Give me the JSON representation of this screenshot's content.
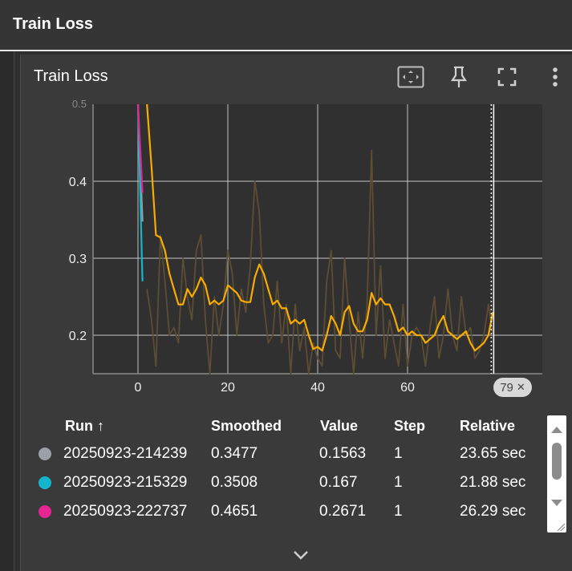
{
  "header": {
    "title": "Train Loss"
  },
  "card": {
    "title": "Train Loss",
    "tools": [
      {
        "name": "fit-domain-icon"
      },
      {
        "name": "pin-icon"
      },
      {
        "name": "fullscreen-icon"
      },
      {
        "name": "more-vert-icon"
      }
    ]
  },
  "colors": {
    "run1": "#9aa0a6",
    "run2": "#12b5cb",
    "run3": "#e52592",
    "run4": "#f9ab00",
    "raw4": "#5c4d33",
    "grid": "#cfcfcf",
    "axis": "#8a8a8a"
  },
  "chart_data": {
    "type": "line",
    "xlim": [
      -10,
      90
    ],
    "ylim": [
      0.15,
      0.5
    ],
    "x_ticks": [
      0,
      20,
      40,
      60
    ],
    "y_ticks": [
      0.2,
      0.3,
      0.4
    ],
    "x_tick_labels": [
      "0",
      "20",
      "40",
      "60"
    ],
    "y_tick_labels": [
      "0.2",
      "0.3",
      "0.4"
    ],
    "top_tick_label": "0.5",
    "hover_step": 79,
    "grid": true,
    "series": [
      {
        "name": "20250923-214239",
        "color": "#9aa0a6",
        "x": [
          0,
          1
        ],
        "y": [
          0.5,
          0.3477
        ]
      },
      {
        "name": "20250923-215329",
        "color": "#12b5cb",
        "x": [
          0,
          1
        ],
        "y": [
          0.5,
          0.27
        ]
      },
      {
        "name": "20250923-222737",
        "color": "#e52592",
        "x": [
          0,
          1
        ],
        "y": [
          0.5,
          0.385
        ]
      },
      {
        "name": "smoothed-4",
        "color": "#f9ab00",
        "x": [
          2,
          3,
          4,
          5,
          6,
          7,
          8,
          9,
          10,
          11,
          12,
          13,
          14,
          15,
          16,
          17,
          18,
          19,
          20,
          21,
          22,
          23,
          24,
          25,
          26,
          27,
          28,
          29,
          30,
          31,
          32,
          33,
          34,
          35,
          36,
          37,
          38,
          39,
          40,
          41,
          42,
          43,
          44,
          45,
          46,
          47,
          48,
          49,
          50,
          51,
          52,
          53,
          54,
          55,
          56,
          57,
          58,
          59,
          60,
          61,
          62,
          63,
          64,
          65,
          66,
          67,
          68,
          69,
          70,
          71,
          72,
          73,
          74,
          75,
          76,
          77,
          78,
          79
        ],
        "y": [
          0.5,
          0.42,
          0.33,
          0.327,
          0.31,
          0.28,
          0.26,
          0.24,
          0.24,
          0.26,
          0.25,
          0.26,
          0.275,
          0.265,
          0.24,
          0.245,
          0.24,
          0.245,
          0.265,
          0.26,
          0.255,
          0.245,
          0.243,
          0.243,
          0.275,
          0.292,
          0.28,
          0.26,
          0.24,
          0.245,
          0.235,
          0.235,
          0.215,
          0.22,
          0.215,
          0.22,
          0.2,
          0.182,
          0.185,
          0.18,
          0.2,
          0.225,
          0.215,
          0.2,
          0.23,
          0.238,
          0.215,
          0.205,
          0.205,
          0.22,
          0.255,
          0.24,
          0.248,
          0.24,
          0.24,
          0.225,
          0.205,
          0.21,
          0.2,
          0.205,
          0.2,
          0.2,
          0.19,
          0.195,
          0.2,
          0.215,
          0.225,
          0.205,
          0.2,
          0.195,
          0.2,
          0.205,
          0.19,
          0.18,
          0.185,
          0.19,
          0.2,
          0.23
        ]
      },
      {
        "name": "raw-4",
        "color": "#5c4d33",
        "x": [
          2,
          3,
          4,
          5,
          6,
          7,
          8,
          9,
          10,
          11,
          12,
          13,
          14,
          15,
          16,
          17,
          18,
          19,
          20,
          21,
          22,
          23,
          24,
          25,
          26,
          27,
          28,
          29,
          30,
          31,
          32,
          33,
          34,
          35,
          36,
          37,
          38,
          39,
          40,
          41,
          42,
          43,
          44,
          45,
          46,
          47,
          48,
          49,
          50,
          51,
          52,
          53,
          54,
          55,
          56,
          57,
          58,
          59,
          60,
          61,
          62,
          63,
          64,
          65,
          66,
          67,
          68,
          69,
          70,
          71,
          72,
          73,
          74,
          75,
          76,
          77,
          78,
          79
        ],
        "y": [
          0.26,
          0.22,
          0.16,
          0.33,
          0.27,
          0.2,
          0.21,
          0.19,
          0.3,
          0.25,
          0.22,
          0.31,
          0.33,
          0.22,
          0.15,
          0.25,
          0.2,
          0.24,
          0.31,
          0.28,
          0.2,
          0.26,
          0.23,
          0.29,
          0.4,
          0.36,
          0.24,
          0.19,
          0.2,
          0.27,
          0.19,
          0.24,
          0.15,
          0.24,
          0.18,
          0.21,
          0.15,
          0.19,
          0.17,
          0.16,
          0.27,
          0.31,
          0.18,
          0.17,
          0.3,
          0.22,
          0.15,
          0.23,
          0.17,
          0.24,
          0.44,
          0.2,
          0.29,
          0.17,
          0.22,
          0.19,
          0.16,
          0.24,
          0.16,
          0.2,
          0.21,
          0.2,
          0.16,
          0.21,
          0.25,
          0.17,
          0.2,
          0.26,
          0.2,
          0.18,
          0.25,
          0.2,
          0.21,
          0.17,
          0.18,
          0.2,
          0.24,
          0.2
        ]
      }
    ]
  },
  "legend": {
    "headers": {
      "run": "Run ↑",
      "smoothed": "Smoothed",
      "value": "Value",
      "step": "Step",
      "relative": "Relative"
    },
    "rows": [
      {
        "run": "20250923-214239",
        "smoothed": "0.3477",
        "value": "0.1563",
        "step": "1",
        "relative": "23.65 sec",
        "color": "#9aa0a6"
      },
      {
        "run": "20250923-215329",
        "smoothed": "0.3508",
        "value": "0.167",
        "step": "1",
        "relative": "21.88 sec",
        "color": "#12b5cb"
      },
      {
        "run": "20250923-222737",
        "smoothed": "0.4651",
        "value": "0.2671",
        "step": "1",
        "relative": "26.29 sec",
        "color": "#e52592"
      }
    ]
  },
  "badge": {
    "step_text": "79",
    "close": "✕"
  }
}
